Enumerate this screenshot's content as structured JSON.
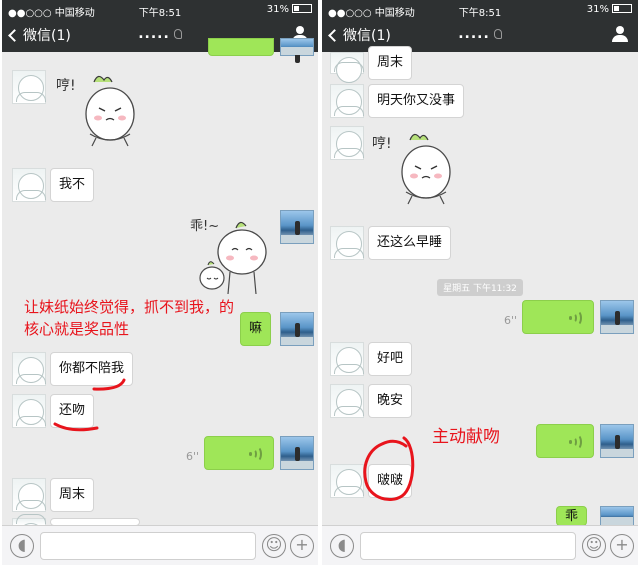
{
  "status_bar": {
    "carrier": "●●○○○ 中国移动",
    "time": "下午8:51",
    "battery": "31%"
  },
  "nav": {
    "back_label": "微信(1)",
    "title": "....."
  },
  "left": {
    "messages": {
      "m1": "我不",
      "m2": "嘛",
      "m3": "你都不陪我",
      "m4": "还吻",
      "m5_duration": "6''",
      "m6": "周末"
    },
    "annotation": "让妹纸始终觉得，抓不到我，的核心就是奖品性",
    "sticker_texts": {
      "s1": "哼!",
      "s2": "乖!~"
    }
  },
  "right": {
    "messages": {
      "m1": "周末",
      "m2": "明天你又没事",
      "m3": "还这么早睡",
      "timestamp": "星期五 下午11:32",
      "m4_duration": "6''",
      "m5": "好吧",
      "m6": "晚安",
      "m7": "啵啵",
      "m8": "乖"
    },
    "annotation": "主动献吻",
    "sticker_texts": {
      "s1": "哼!"
    }
  },
  "colors": {
    "accent_red": "#e8141c",
    "bubble_green": "#9fe658",
    "topbar": "#2e3132"
  }
}
